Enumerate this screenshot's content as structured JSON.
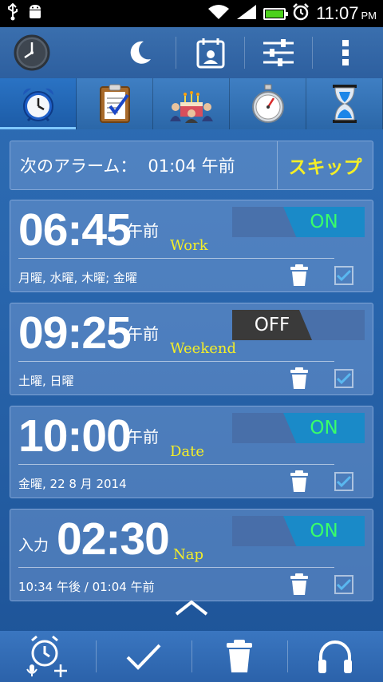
{
  "status_bar": {
    "time": "11:07",
    "ampm": "PM",
    "icons": [
      "usb-icon",
      "android-icon",
      "wifi-icon",
      "signal-icon",
      "battery-icon",
      "alarm-clock-icon"
    ]
  },
  "action_bar": {
    "icons": [
      "analog-clock-icon",
      "moon-icon",
      "calendar-icon",
      "sliders-icon",
      "overflow-menu-icon"
    ]
  },
  "tabs": [
    {
      "icon": "alarm-clock-icon"
    },
    {
      "icon": "clipboard-icon"
    },
    {
      "icon": "birthday-cake-icon"
    },
    {
      "icon": "stopwatch-icon"
    },
    {
      "icon": "hourglass-icon"
    }
  ],
  "next_alarm": {
    "label": "次のアラーム：",
    "time": "01:04 午前",
    "skip_label": "スキップ"
  },
  "alarms": [
    {
      "prefix": "",
      "time": "06:45",
      "ampm": "午前",
      "name": "Work",
      "days": "月曜, 水曜, 木曜; 金曜",
      "state": "ON",
      "enabled": true
    },
    {
      "prefix": "",
      "time": "09:25",
      "ampm": "午前",
      "name": "Weekend",
      "days": "土曜, 日曜",
      "state": "OFF",
      "enabled": false
    },
    {
      "prefix": "",
      "time": "10:00",
      "ampm": "午前",
      "name": "Date",
      "days": "金曜, 22  8 月 2014",
      "state": "ON",
      "enabled": true
    },
    {
      "prefix": "入力",
      "time": "02:30",
      "ampm": "",
      "name": "Nap",
      "days": "10:34 午後 / 01:04 午前",
      "state": "ON",
      "enabled": true
    }
  ],
  "bottom_bar": {
    "icons": [
      "add-voice-alarm-icon",
      "checkmark-icon",
      "trash-icon",
      "headphones-icon"
    ]
  },
  "colors": {
    "accent_yellow": "#f4ee27",
    "on_green": "#39ff6a",
    "toggle_blue": "#1a8ac8",
    "check_blue": "#5ab8f0"
  }
}
